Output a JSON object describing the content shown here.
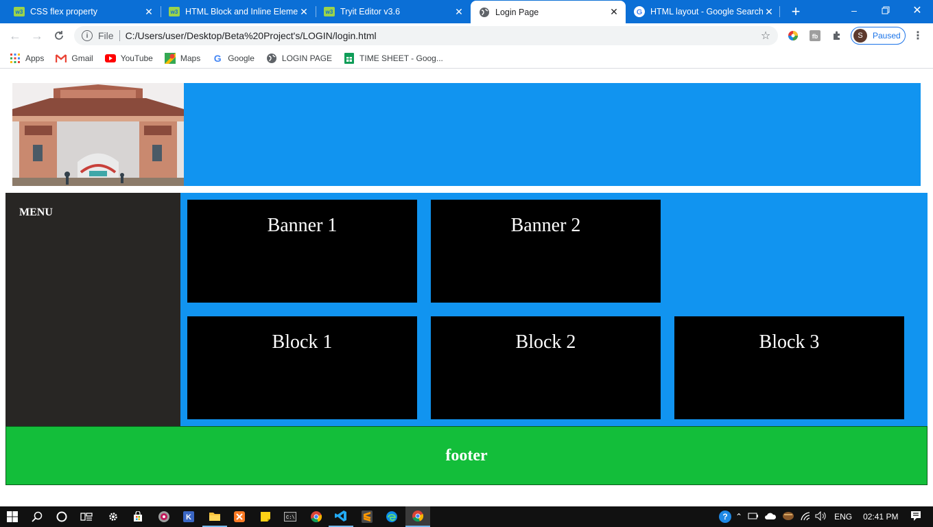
{
  "browser": {
    "tabs": [
      {
        "title": "CSS flex property",
        "favicon": "w3schools-icon",
        "active": false
      },
      {
        "title": "HTML Block and Inline Elemen",
        "favicon": "w3schools-icon",
        "active": false
      },
      {
        "title": "Tryit Editor v3.6",
        "favicon": "w3schools-icon",
        "active": false
      },
      {
        "title": "Login Page",
        "favicon": "globe-icon",
        "active": true
      },
      {
        "title": "HTML layout - Google Search",
        "favicon": "google-icon",
        "active": false
      }
    ],
    "new_tab_label": "+",
    "address": {
      "scheme_label": "File",
      "url": "C:/Users/user/Desktop/Beta%20Project's/LOGIN/login.html"
    },
    "profile": {
      "initial": "S",
      "status": "Paused"
    },
    "bookmarks": [
      {
        "label": "Apps",
        "icon": "apps-grid-icon"
      },
      {
        "label": "Gmail",
        "icon": "gmail-icon"
      },
      {
        "label": "YouTube",
        "icon": "youtube-icon"
      },
      {
        "label": "Maps",
        "icon": "maps-icon"
      },
      {
        "label": "Google",
        "icon": "google-icon"
      },
      {
        "label": "LOGIN PAGE",
        "icon": "globe-icon"
      },
      {
        "label": "TIME SHEET - Goog...",
        "icon": "sheets-icon"
      }
    ]
  },
  "page": {
    "menu_label": "MENU",
    "banners": [
      "Banner 1",
      "Banner 2"
    ],
    "blocks": [
      "Block 1",
      "Block 2",
      "Block 3"
    ],
    "footer_label": "footer",
    "colors": {
      "header_bg": "#1194f0",
      "menu_bg": "#282624",
      "box_bg": "#000000",
      "footer_bg": "#13be3a"
    }
  },
  "taskbar": {
    "language": "ENG",
    "time": "02:41 PM"
  }
}
